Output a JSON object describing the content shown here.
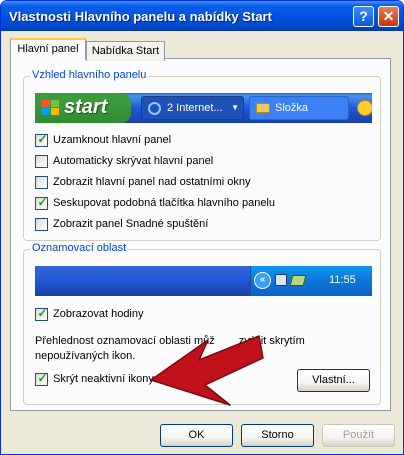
{
  "window": {
    "title": "Vlastnosti Hlavního panelu a nabídky Start",
    "help_label": "?",
    "close_label": "✕"
  },
  "tabs": [
    {
      "label": "Hlavní panel",
      "active": true
    },
    {
      "label": "Nabídka Start",
      "active": false
    }
  ],
  "taskbar_appearance": {
    "group_label": "Vzhled hlavního panelu",
    "preview": {
      "start_label": "start",
      "items": [
        {
          "label": "2 Internet...",
          "icon": "internet-explorer-icon",
          "has_dropdown": true
        },
        {
          "label": "Složka",
          "icon": "folder-icon"
        }
      ]
    },
    "options": [
      {
        "label": "Uzamknout hlavní panel",
        "checked": true
      },
      {
        "label": "Automaticky skrývat hlavní panel",
        "checked": false
      },
      {
        "label": "Zobrazit hlavní panel nad ostatními okny",
        "checked": false
      },
      {
        "label": "Seskupovat podobná tlačítka hlavního panelu",
        "checked": true
      },
      {
        "label": "Zobrazit panel Snadné spuštění",
        "checked": false
      }
    ]
  },
  "notification_area": {
    "group_label": "Oznamovací oblast",
    "preview": {
      "expand_icon": "double-chevron-left-icon",
      "clock": "11:55"
    },
    "show_clock": {
      "label": "Zobrazovat hodiny",
      "checked": true
    },
    "description": "Přehlednost oznamovací oblasti můžete zvýšit skrytím nepoužívaných ikon.",
    "description_line1": "Přehlednost oznamovací oblasti můž",
    "description_line1_tail": "zvýšit skrytím",
    "description_line2": "nepoužívaných ikon.",
    "hide_inactive": {
      "label": "Skrýt neaktivní ikony",
      "checked": true
    },
    "customize_label": "Vlastní..."
  },
  "annotation": {
    "color": "#c1121b"
  },
  "footer": {
    "ok_label": "OK",
    "cancel_label": "Storno",
    "apply_label": "Použít",
    "apply_enabled": false
  },
  "colors": {
    "title_bar": "#0054e3",
    "group_label": "#0046d5",
    "dialog_bg": "#ece9d8"
  }
}
